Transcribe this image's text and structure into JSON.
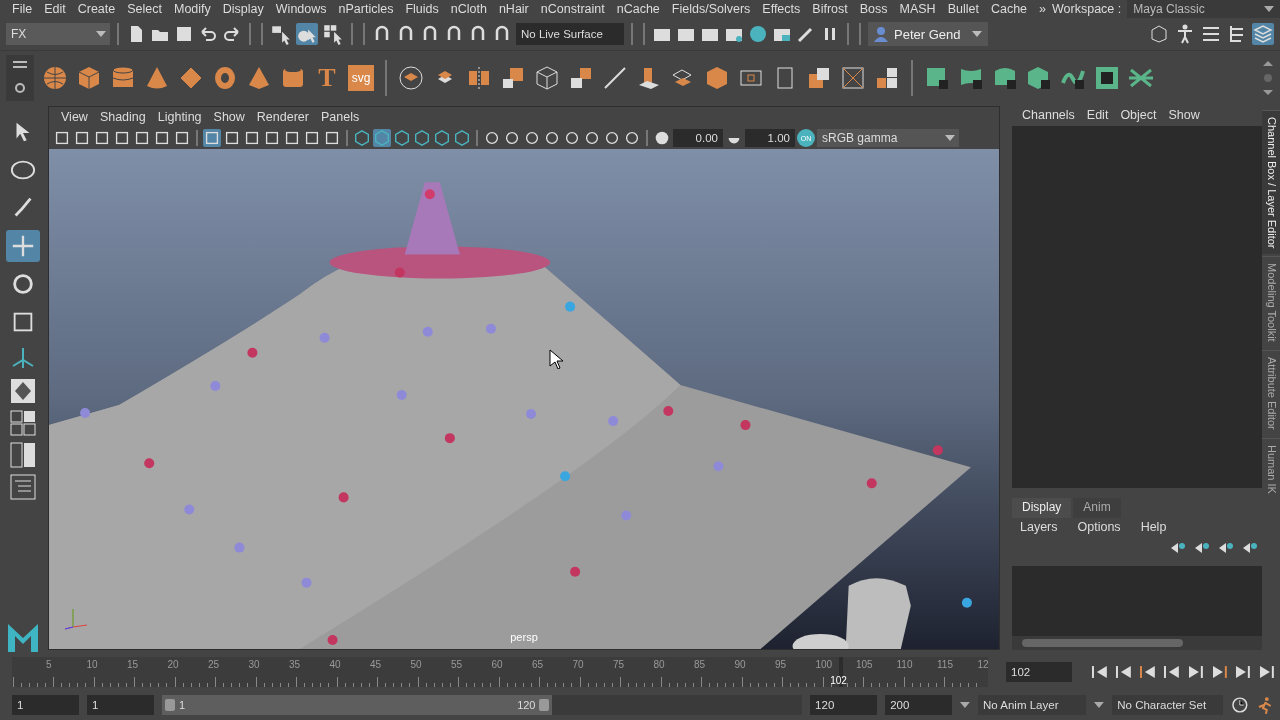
{
  "menu_bar": {
    "items": [
      "File",
      "Edit",
      "Create",
      "Select",
      "Modify",
      "Display",
      "Windows",
      "nParticles",
      "Fluids",
      "nCloth",
      "nHair",
      "nConstraint",
      "nCache",
      "Fields/Solvers",
      "Effects",
      "Bifrost",
      "Boss",
      "MASH",
      "Bullet",
      "Cache"
    ],
    "overflow": "»",
    "workspace_label": "Workspace :",
    "workspace": "Maya Classic"
  },
  "status_line": {
    "menu_set": "FX",
    "select_modes": [
      {
        "selected": false
      },
      {
        "selected": true
      },
      {
        "selected": false
      }
    ],
    "live_surface": "No Live Surface",
    "user": "Peter Gend",
    "panel_toggles": [
      {
        "selected": false
      },
      {
        "selected": false
      },
      {
        "selected": false
      },
      {
        "selected": false
      },
      {
        "selected": true
      }
    ]
  },
  "shelf": {
    "text_tools": [
      "T",
      "svg"
    ]
  },
  "toolbox": {
    "tools": [
      {
        "selected": false
      },
      {
        "selected": false
      },
      {
        "selected": false
      },
      {
        "selected": true
      },
      {
        "selected": false
      },
      {
        "selected": false
      }
    ]
  },
  "viewport": {
    "menus": [
      "View",
      "Shading",
      "Lighting",
      "Show",
      "Renderer",
      "Panels"
    ],
    "grid_toggles": [
      {
        "selected": true
      },
      {
        "selected": false
      },
      {
        "selected": false
      },
      {
        "selected": false
      },
      {
        "selected": false
      },
      {
        "selected": false
      },
      {
        "selected": false
      }
    ],
    "shading_toggles": [
      {
        "selected": false
      },
      {
        "selected": true
      },
      {
        "selected": false
      },
      {
        "selected": false
      },
      {
        "selected": false
      },
      {
        "selected": false
      }
    ],
    "exposure": "0.00",
    "gamma": "1.00",
    "color_management": {
      "on": true,
      "badge": "ON",
      "view_transform": "sRGB gamma"
    },
    "camera": "persp",
    "scene": {
      "kind": "picture"
    }
  },
  "channel_box": {
    "menus": [
      "Channels",
      "Edit",
      "Object",
      "Show"
    ]
  },
  "layer_editor": {
    "tabs": [
      {
        "label": "Display",
        "selected": true
      },
      {
        "label": "Anim",
        "selected": false
      }
    ],
    "menus": [
      "Layers",
      "Options",
      "Help"
    ]
  },
  "side_tabs": [
    {
      "label": "Channel Box / Layer Editor",
      "selected": true
    },
    {
      "label": "Modeling Toolkit",
      "selected": false
    },
    {
      "label": "Attribute Editor",
      "selected": false
    },
    {
      "label": "Human IK",
      "selected": false
    }
  ],
  "time_slider": {
    "tick_labels": [
      "5",
      "10",
      "15",
      "20",
      "25",
      "30",
      "35",
      "40",
      "45",
      "50",
      "55",
      "60",
      "65",
      "70",
      "75",
      "80",
      "85",
      "90",
      "95",
      "100",
      "105",
      "110",
      "115",
      "12"
    ],
    "current_frame": "102",
    "level": 0.85,
    "frame_field": "102"
  },
  "range_slider": {
    "start_time": "1",
    "playback_start": "1",
    "range_start": "1",
    "range_end": "120",
    "level": 0.61,
    "playback_end": "120",
    "end_time": "200",
    "anim_layer": "No Anim Layer",
    "character_set": "No Character Set"
  }
}
